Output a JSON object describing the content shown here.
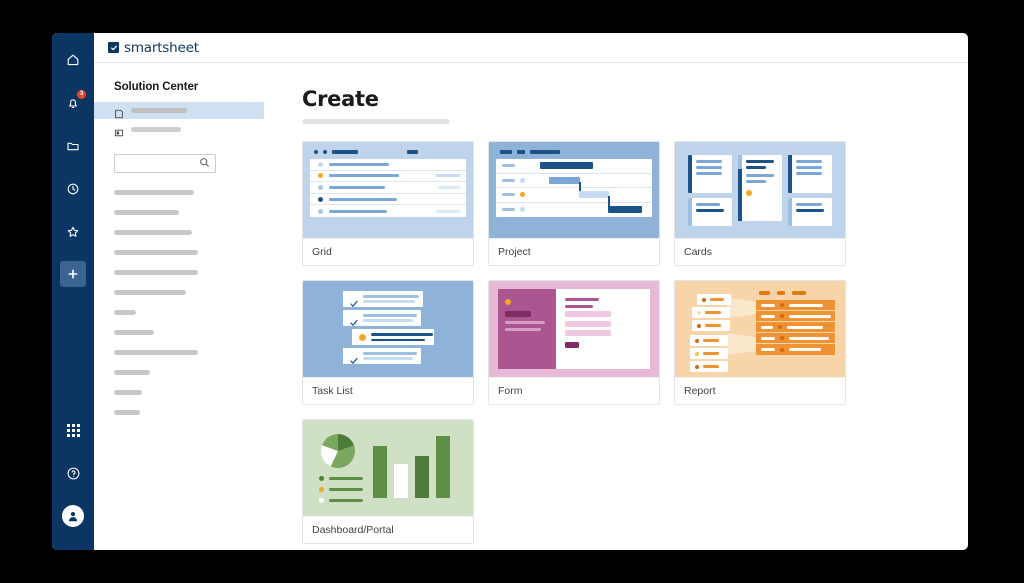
{
  "app": {
    "logo_text": "smartsheet",
    "logo_icon": "smartsheet-checkbox-logo"
  },
  "rail": {
    "items": [
      {
        "name": "home",
        "icon": "home-icon",
        "badge": null
      },
      {
        "name": "notifications",
        "icon": "bell-icon",
        "badge": "3"
      },
      {
        "name": "browse",
        "icon": "folder-icon",
        "badge": null
      },
      {
        "name": "recents",
        "icon": "clock-icon",
        "badge": null
      },
      {
        "name": "favorites",
        "icon": "star-icon",
        "badge": null
      },
      {
        "name": "create",
        "icon": "plus-icon",
        "badge": null
      }
    ],
    "bottom_items": [
      {
        "name": "apps-launcher",
        "icon": "grid-dots-icon"
      },
      {
        "name": "help",
        "icon": "question-circle-icon"
      },
      {
        "name": "account",
        "icon": "user-avatar-icon"
      }
    ],
    "accent_bg": "#0b3562",
    "active_bg": "#3c6490",
    "badge_color": "#e8432f"
  },
  "navpanel": {
    "title": "Solution Center",
    "items": [
      {
        "icon": "sheet-icon",
        "label": "",
        "skeleton_width": 56,
        "active": true
      },
      {
        "icon": "template-icon",
        "label": "",
        "skeleton_width": 50,
        "active": false
      }
    ],
    "search": {
      "placeholder": "",
      "value": "",
      "icon": "search-icon"
    },
    "skeleton_widths": [
      80,
      65,
      78,
      84,
      84,
      72,
      22,
      40,
      84,
      36,
      28,
      26
    ]
  },
  "main": {
    "title": "Create",
    "tiles": [
      {
        "label": "Grid",
        "art": "grid",
        "bg": "#bfd4ea"
      },
      {
        "label": "Project",
        "art": "project",
        "bg": "#8fb2d8"
      },
      {
        "label": "Cards",
        "art": "cards",
        "bg": "#bfd4ea"
      },
      {
        "label": "Task List",
        "art": "task",
        "bg": "#8fb2d8"
      },
      {
        "label": "Form",
        "art": "form",
        "bg": "#e8b9d6"
      },
      {
        "label": "Report",
        "art": "report",
        "bg": "#f7d5a8"
      },
      {
        "label": "Dashboard/Portal",
        "art": "dash",
        "bg": "#cfe0c4"
      }
    ]
  },
  "colors": {
    "navy": "#0b3562",
    "blue_dark": "#1b5287",
    "blue_mid": "#7aa7d8",
    "blue_light": "#c6dcf2",
    "amber": "#f5a623",
    "magenta": "#ab5591",
    "pink_light": "#e8b9d6",
    "orange": "#ef9234",
    "green_dark": "#4e7b3a",
    "green_mid": "#7aa95e",
    "skeleton_gray": "#c7c7c7"
  }
}
